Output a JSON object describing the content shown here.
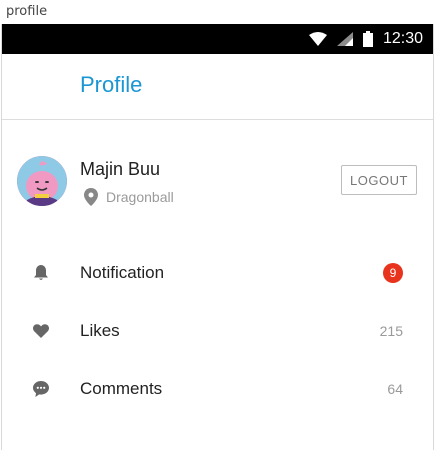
{
  "window": {
    "title": "profile"
  },
  "status_bar": {
    "time": "12:30"
  },
  "app_bar": {
    "title": "Profile"
  },
  "profile": {
    "name": "Majin Buu",
    "location": "Dragonball",
    "logout_label": "LOGOUT"
  },
  "menu": {
    "items": [
      {
        "label": "Notification",
        "icon": "bell-icon",
        "badge": "9"
      },
      {
        "label": "Likes",
        "icon": "heart-icon",
        "count": "215"
      },
      {
        "label": "Comments",
        "icon": "comment-icon",
        "count": "64"
      }
    ]
  },
  "colors": {
    "accent": "#1a96d4",
    "badge": "#e8341c",
    "muted_text": "#9a9a9a",
    "icon": "#666666"
  }
}
